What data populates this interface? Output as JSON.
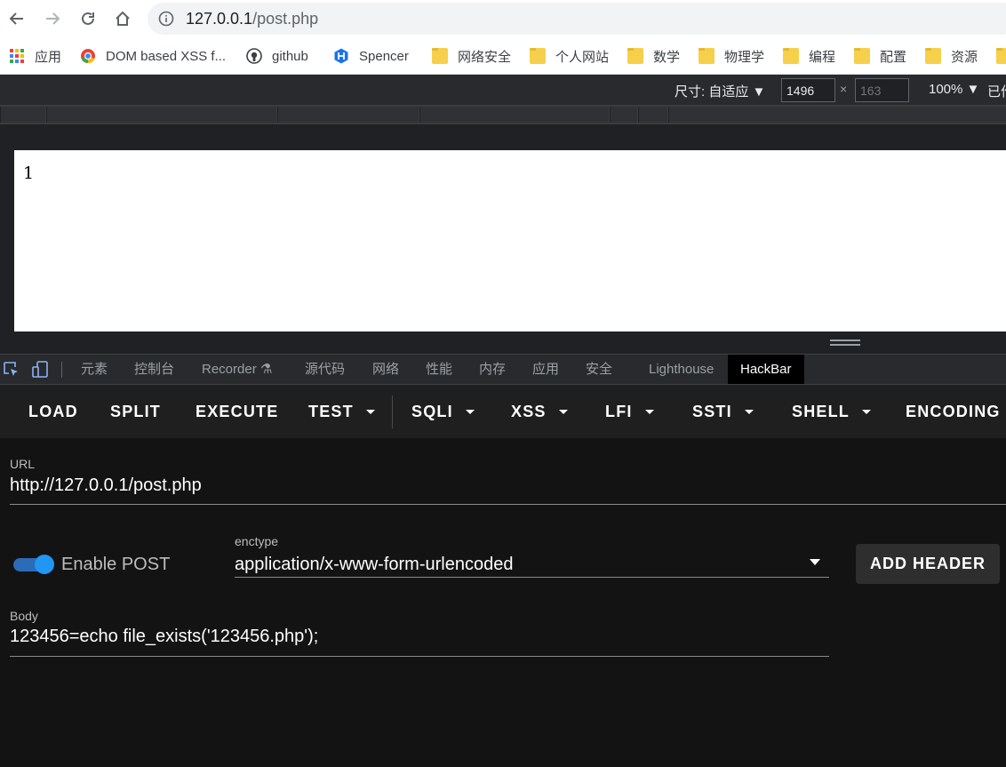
{
  "browser": {
    "url_host": "127.0.0.1",
    "url_path": "/post.php",
    "icons": [
      "back-arrow-icon",
      "forward-arrow-icon",
      "reload-icon",
      "home-icon",
      "info-icon"
    ]
  },
  "bookmarks": [
    {
      "label": "应用",
      "icon": "apps-grid-icon"
    },
    {
      "label": "DOM based XSS f...",
      "icon": "chrome-icon"
    },
    {
      "label": "github",
      "icon": "github-icon"
    },
    {
      "label": "Spencer",
      "icon": "hexagon-h-icon"
    },
    {
      "label": "网络安全",
      "icon": "folder-icon"
    },
    {
      "label": "个人网站",
      "icon": "folder-icon"
    },
    {
      "label": "数学",
      "icon": "folder-icon"
    },
    {
      "label": "物理学",
      "icon": "folder-icon"
    },
    {
      "label": "编程",
      "icon": "folder-icon"
    },
    {
      "label": "配置",
      "icon": "folder-icon"
    },
    {
      "label": "资源",
      "icon": "folder-icon"
    }
  ],
  "device_toolbar": {
    "dimensions_label": "尺寸: 自适应 ▼",
    "width_value": "1496",
    "height_placeholder": "163",
    "times": "×",
    "zoom_label": "100% ▼",
    "more_label": "已作"
  },
  "page": {
    "output": "1"
  },
  "devtools_tabs": [
    "元素",
    "控制台",
    "Recorder ⚗",
    "源代码",
    "网络",
    "性能",
    "内存",
    "应用",
    "安全",
    "Lighthouse",
    "HackBar"
  ],
  "active_tab": "HackBar",
  "hackbar": {
    "menu": [
      {
        "label": "LOAD",
        "dropdown": false
      },
      {
        "label": "SPLIT",
        "dropdown": false
      },
      {
        "label": "EXECUTE",
        "dropdown": false
      },
      {
        "label": "TEST",
        "dropdown": true
      },
      {
        "label": "SQLI",
        "dropdown": true
      },
      {
        "label": "XSS",
        "dropdown": true
      },
      {
        "label": "LFI",
        "dropdown": true
      },
      {
        "label": "SSTI",
        "dropdown": true
      },
      {
        "label": "SHELL",
        "dropdown": true
      },
      {
        "label": "ENCODING",
        "dropdown": false
      }
    ],
    "url_label": "URL",
    "url_value": "http://127.0.0.1/post.php",
    "enable_post_label": "Enable POST",
    "enable_post": true,
    "enctype_label": "enctype",
    "enctype_value": "application/x-www-form-urlencoded",
    "add_header_label": "ADD HEADER",
    "body_label": "Body",
    "body_value": "123456=echo file_exists('123456.php');"
  },
  "colors": {
    "toggle_accent": "#2196f3",
    "hackbar_bg": "#131313"
  }
}
